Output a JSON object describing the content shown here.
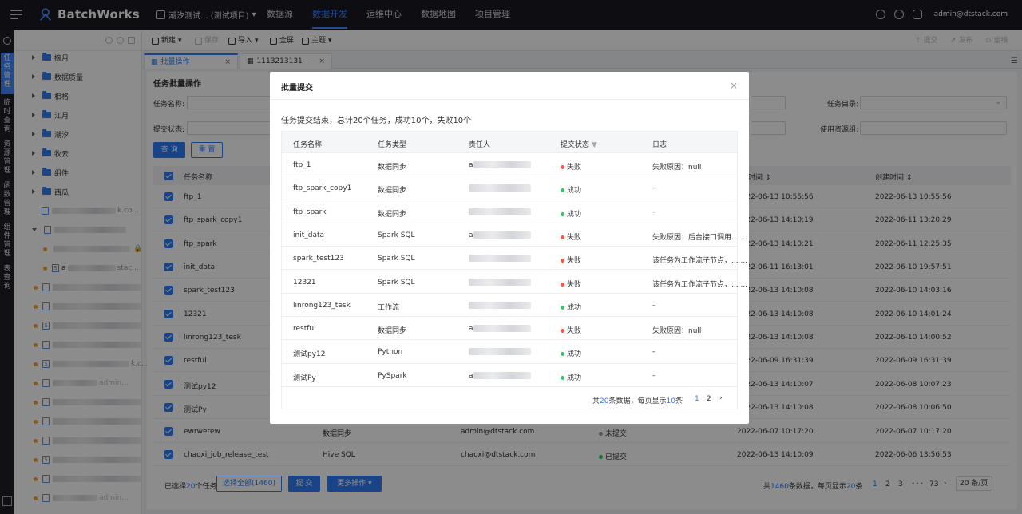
{
  "app": {
    "name": "BatchWorks",
    "project": "潮汐测试... (测试项目)",
    "user": "admin@dtstack.com"
  },
  "nav": [
    "数据源",
    "数据开发",
    "运维中心",
    "数据地图",
    "项目管理"
  ],
  "rail_tabs": [
    "任务管理",
    "临时查询",
    "资源管理",
    "函数管理",
    "组件管理",
    "表查询"
  ],
  "tree": {
    "folders": [
      "摘月",
      "数据质量",
      "相格",
      "江月",
      "潮汐",
      "牧云",
      "组件",
      "西瓜"
    ],
    "files": [
      {
        "label": "",
        "suffix": "k.co..."
      },
      {
        "label": "",
        "suffix": ""
      },
      {
        "label": "",
        "suffix": ""
      },
      {
        "label": "a",
        "suffix": "stac..."
      },
      {
        "label": "",
        "suffix": ""
      },
      {
        "label": "",
        "suffix": ""
      },
      {
        "label": "",
        "suffix": ""
      },
      {
        "label": "",
        "suffix": ""
      },
      {
        "label": "",
        "suffix": "k.c..."
      },
      {
        "label": "",
        "suffix": "admin..."
      },
      {
        "label": "",
        "suffix": ""
      },
      {
        "label": "",
        "suffix": ""
      },
      {
        "label": "",
        "suffix": ""
      },
      {
        "label": "",
        "suffix": ""
      },
      {
        "label": "",
        "suffix": ""
      },
      {
        "label": "",
        "suffix": "admin..."
      }
    ]
  },
  "toolbar": {
    "new": "新建",
    "save": "保存",
    "import": "导入",
    "fullscreen": "全屏",
    "theme": "主题",
    "submit": "提交",
    "publish": "发布",
    "ops": "运维"
  },
  "tabs": [
    "批量操作",
    "1113213131"
  ],
  "page": {
    "title": "任务批量操作",
    "task_name_label": "任务名称:",
    "submit_status_label": "提交状态:",
    "task_dir_label": "任务目录:",
    "resource_group_label": "使用资源组:",
    "query_btn": "查 询",
    "reset_btn": "重 置"
  },
  "main_table": {
    "headers": {
      "name": "任务名称",
      "mtime": "时间",
      "ctime": "创建时间"
    },
    "rows": [
      {
        "name": "ftp_1",
        "type": "",
        "owner": "",
        "status": "",
        "mtime": "2022-06-13 10:55:56",
        "ctime": "2022-06-13 10:55:56"
      },
      {
        "name": "ftp_spark_copy1",
        "type": "",
        "owner": "",
        "status": "",
        "mtime": "2022-06-13 14:10:19",
        "ctime": "2022-06-11 13:20:29"
      },
      {
        "name": "ftp_spark",
        "type": "",
        "owner": "",
        "status": "",
        "mtime": "2022-06-13 14:10:21",
        "ctime": "2022-06-11 12:25:35"
      },
      {
        "name": "init_data",
        "type": "",
        "owner": "",
        "status": "",
        "mtime": "2022-06-11 16:13:01",
        "ctime": "2022-06-10 19:57:51"
      },
      {
        "name": "spark_test123",
        "type": "",
        "owner": "",
        "status": "",
        "mtime": "2022-06-13 14:10:08",
        "ctime": "2022-06-10 14:03:16"
      },
      {
        "name": "12321",
        "type": "",
        "owner": "",
        "status": "",
        "mtime": "2022-06-13 14:10:08",
        "ctime": "2022-06-10 14:01:24"
      },
      {
        "name": "linrong123_tesk",
        "type": "",
        "owner": "",
        "status": "",
        "mtime": "2022-06-13 14:10:08",
        "ctime": "2022-06-10 14:00:52"
      },
      {
        "name": "restful",
        "type": "",
        "owner": "",
        "status": "",
        "mtime": "2022-06-09 16:31:39",
        "ctime": "2022-06-09 16:31:39"
      },
      {
        "name": "测试py12",
        "type": "",
        "owner": "",
        "status": "",
        "mtime": "2022-06-13 14:10:07",
        "ctime": "2022-06-08 10:07:23"
      },
      {
        "name": "测试Py",
        "type": "",
        "owner": "",
        "status": "",
        "mtime": "2022-06-13 14:10:08",
        "ctime": "2022-06-08 10:06:50"
      },
      {
        "name": "ewrwerew",
        "type": "数据同步",
        "owner": "admin@dtstack.com",
        "status": "未提交",
        "mtime": "2022-06-07 10:17:20",
        "ctime": "2022-06-07 10:17:20"
      },
      {
        "name": "chaoxi_job_release_test",
        "type": "Hive SQL",
        "owner": "chaoxi@dtstack.com",
        "status": "已提交",
        "mtime": "2022-06-13 14:10:09",
        "ctime": "2022-06-06 13:56:53"
      }
    ]
  },
  "footer": {
    "selected_prefix": "已选择",
    "selected_count": "20",
    "selected_suffix": "个任务",
    "select_all": "选择全部(1460)",
    "submit": "提 交",
    "more": "更多操作",
    "total_prefix": "共",
    "total": "1460",
    "total_mid": "条数据，每页显示",
    "per_page": "20",
    "total_suffix": "条",
    "pages": [
      "1",
      "2",
      "3",
      "•••",
      "73"
    ],
    "page_size": "20 条/页"
  },
  "modal": {
    "title": "批量提交",
    "summary": "任务提交结束，总计20个任务，成功10个，失败10个",
    "headers": {
      "name": "任务名称",
      "type": "任务类型",
      "owner": "责任人",
      "status": "提交状态",
      "log": "日志"
    },
    "rows": [
      {
        "name": "ftp_1",
        "type": "数据同步",
        "owner": "a",
        "status": "失败",
        "log": "失败原因：null"
      },
      {
        "name": "ftp_spark_copy1",
        "type": "数据同步",
        "owner": "",
        "status": "成功",
        "log": "-"
      },
      {
        "name": "ftp_spark",
        "type": "数据同步",
        "owner": "",
        "status": "成功",
        "log": "-"
      },
      {
        "name": "init_data",
        "type": "Spark SQL",
        "owner": "a",
        "status": "失败",
        "log": "失败原因：后台接口调用... ..."
      },
      {
        "name": "spark_test123",
        "type": "Spark SQL",
        "owner": "",
        "status": "失败",
        "log": "该任务为工作流子节点，... ..."
      },
      {
        "name": "12321",
        "type": "Spark SQL",
        "owner": "",
        "status": "失败",
        "log": "该任务为工作流子节点，... ..."
      },
      {
        "name": "linrong123_tesk",
        "type": "工作流",
        "owner": "",
        "status": "成功",
        "log": "-"
      },
      {
        "name": "restful",
        "type": "数据同步",
        "owner": "a",
        "status": "失败",
        "log": "失败原因：null"
      },
      {
        "name": "测试py12",
        "type": "Python",
        "owner": "",
        "status": "成功",
        "log": "-"
      },
      {
        "name": "测试Py",
        "type": "PySpark",
        "owner": "a",
        "status": "成功",
        "log": "-"
      }
    ],
    "footer": {
      "prefix": "共",
      "total": "20",
      "mid": "条数据，每页显示",
      "per_page": "10",
      "suffix": "条",
      "pages": [
        "1",
        "2"
      ]
    }
  },
  "colors": {
    "accent": "#2f7cf6",
    "fail": "#f5574b",
    "success": "#3cc36a",
    "pending": "#9aa0a8",
    "nav_bg": "#1a1b22"
  }
}
